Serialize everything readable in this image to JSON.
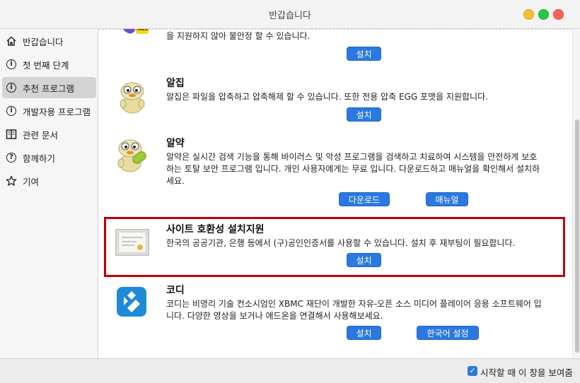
{
  "window": {
    "title": "반갑습니다"
  },
  "sidebar": {
    "items": [
      {
        "label": "반갑습니다",
        "icon": "home-icon"
      },
      {
        "label": "첫 번째 단계",
        "icon": "info-icon"
      },
      {
        "label": "추천 프로그램",
        "icon": "info-icon",
        "selected": true
      },
      {
        "label": "개발자용 프로그램",
        "icon": "info-icon"
      },
      {
        "label": "관련 문서",
        "icon": "book-icon"
      },
      {
        "label": "함께하기",
        "icon": "question-icon"
      },
      {
        "label": "기여",
        "icon": "star-icon"
      }
    ]
  },
  "programs": [
    {
      "title": "",
      "desc": "을 지원하지 않아 불안정 할 수 있습니다.",
      "buttons": [
        "설치"
      ],
      "icon": "kakaotalk-icon"
    },
    {
      "title": "알집",
      "desc": "알집은 파일을 압축하고 압축해제 할 수 있습니다. 또한 전용 압축 EGG 포맷을 지원합니다.",
      "buttons": [
        "설치"
      ],
      "icon": "alzip-icon"
    },
    {
      "title": "알약",
      "desc_lines": [
        "알약은 실시간 검색 기능을 통해 바이러스 및 악성 프로그램을 검색하고 치료하여 시스템을 안전하게 보호",
        "하는 토탈 보안 프로그램 입니다. 개인 사용자에게는 무료 입니다. 다운로드하고 매뉴얼을 확인해서 설치하",
        "세요."
      ],
      "buttons": [
        "다운로드",
        "매뉴얼"
      ],
      "icon": "alyac-icon"
    },
    {
      "title": "사이트 호환성 설치지원",
      "desc": "한국의 공공기관, 은행 등에서 (구)공인인증서를 사용할 수 있습니다. 설치 후 재부팅이 필요합니다.",
      "buttons": [
        "설치"
      ],
      "icon": "certificate-icon"
    },
    {
      "title": "코디",
      "desc_lines": [
        "코디는 비영리 기술 컨소시엄인 XBMC 재단이 개발한 자유-오픈 소스 미디어 플레이어 응용 소프트웨어 입",
        "니다. 다양한 영상을 보거나 애드온을 연결해서 사용해보세요."
      ],
      "buttons": [
        "설치",
        "한국어 설정"
      ],
      "icon": "kodi-icon"
    }
  ],
  "footer": {
    "checkbox_label": "시작할 때 이 창을 보여줌",
    "checked": true
  },
  "colors": {
    "accent": "#2b79e0",
    "highlight": "#c00000"
  }
}
